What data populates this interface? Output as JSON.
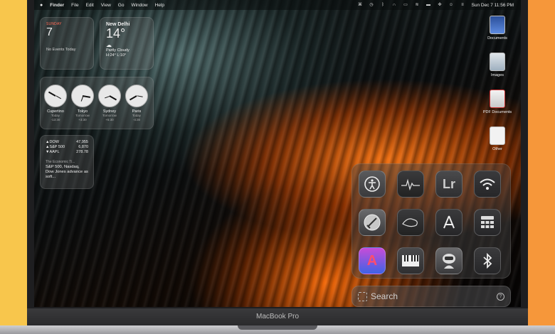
{
  "menubar": {
    "apple": "",
    "items": [
      "Finder",
      "File",
      "Edit",
      "View",
      "Go",
      "Window",
      "Help"
    ],
    "clock": "Sun Dec 7  11:56 PM"
  },
  "calendar_widget": {
    "day": "SUNDAY",
    "date": "7",
    "events": "No Events Today"
  },
  "weather_widget": {
    "city": "New Delhi",
    "temp": "14°",
    "condition": "Partly Cloudy",
    "range": "H:24° L:10°"
  },
  "clocks": [
    {
      "city": "Cupertino",
      "day": "Today",
      "offset": "-13:30"
    },
    {
      "city": "Tokyo",
      "day": "Tomorrow",
      "offset": "+3:30"
    },
    {
      "city": "Sydney",
      "day": "Tomorrow",
      "offset": "+5:30"
    },
    {
      "city": "Paris",
      "day": "Today",
      "offset": "-4:30"
    }
  ],
  "stocks": {
    "rows": [
      {
        "symbol": "▲DOW",
        "value": "47,955"
      },
      {
        "symbol": "▲S&P 500",
        "value": "6,870"
      },
      {
        "symbol": "▼AAPL",
        "value": "278.78"
      }
    ],
    "source": "The Economic Ti...",
    "headline": "S&P 500, Nasdaq, Dow Jones advance as soft..."
  },
  "desktop_icons": [
    "Documents",
    "Images",
    "PDF Documents",
    "Other"
  ],
  "search": {
    "placeholder": "Search",
    "help": "?"
  },
  "bezel": {
    "brand": "MacBook Pro"
  }
}
